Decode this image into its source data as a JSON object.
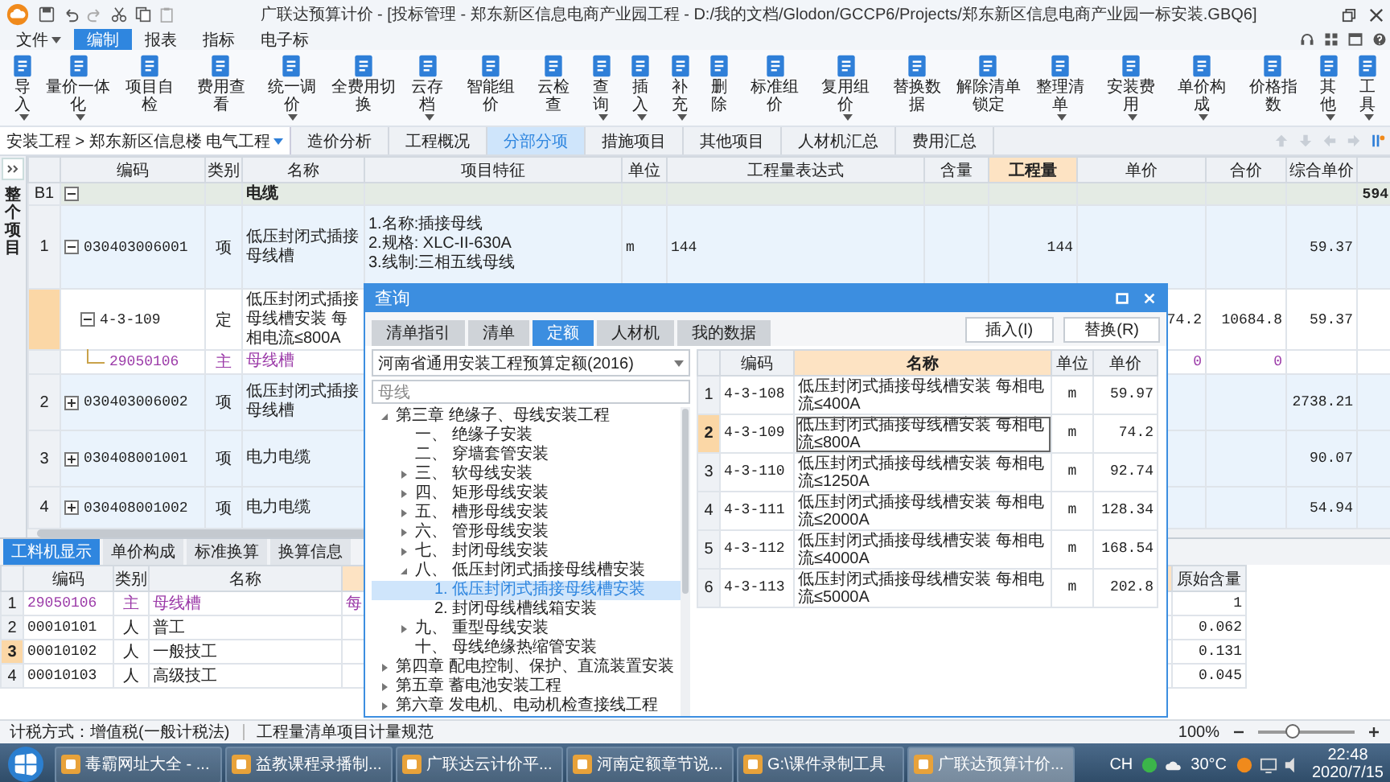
{
  "window": {
    "title": "广联达预算计价 - [投标管理 - 郑东新区信息电商产业园工程 - D:/我的文档/Glodon/GCCP6/Projects/郑东新区信息电商产业园一标安装.GBQ6]"
  },
  "menu": [
    {
      "label": "文件",
      "dropdown": true,
      "selected": false
    },
    {
      "label": "编制",
      "selected": true
    },
    {
      "label": "报表",
      "selected": false
    },
    {
      "label": "指标",
      "selected": false
    },
    {
      "label": "电子标",
      "selected": false
    }
  ],
  "ribbon": [
    {
      "label": "导入",
      "dropdown": true
    },
    {
      "label": "量价一体化",
      "dropdown": true
    },
    {
      "label": "项目自检"
    },
    {
      "label": "费用查看"
    },
    {
      "label": "统一调价",
      "dropdown": true
    },
    {
      "label": "全费用切换"
    },
    {
      "label": "云存档",
      "dropdown": true
    },
    {
      "label": "智能组价"
    },
    {
      "label": "云检查"
    },
    {
      "label": "查询",
      "dropdown": true
    },
    {
      "label": "插入",
      "dropdown": true
    },
    {
      "label": "补充",
      "dropdown": true
    },
    {
      "label": "删除"
    },
    {
      "label": "标准组价"
    },
    {
      "label": "复用组价",
      "dropdown": true
    },
    {
      "label": "替换数据"
    },
    {
      "label": "解除清单锁定"
    },
    {
      "label": "整理清单",
      "dropdown": true
    },
    {
      "label": "安装费用",
      "dropdown": true
    },
    {
      "label": "单价构成",
      "dropdown": true
    },
    {
      "label": "价格指数"
    },
    {
      "label": "其他",
      "dropdown": true
    },
    {
      "label": "工具",
      "dropdown": true
    }
  ],
  "nav": {
    "breadcrumb": "安装工程 > 郑东新区信息楼 电气工程",
    "tabs": [
      {
        "label": "造价分析",
        "selected": false
      },
      {
        "label": "工程概况",
        "selected": false
      },
      {
        "label": "分部分项",
        "selected": true
      },
      {
        "label": "措施项目",
        "selected": false
      },
      {
        "label": "其他项目",
        "selected": false
      },
      {
        "label": "人材机汇总",
        "selected": false
      },
      {
        "label": "费用汇总",
        "selected": false
      }
    ]
  },
  "main": {
    "side_label": "整个项目",
    "columns": [
      {
        "label": "编码",
        "highlighted": false
      },
      {
        "label": "类别",
        "highlighted": false
      },
      {
        "label": "名称",
        "highlighted": false
      },
      {
        "label": "项目特征",
        "highlighted": false
      },
      {
        "label": "单位",
        "highlighted": false
      },
      {
        "label": "工程量表达式",
        "highlighted": false
      },
      {
        "label": "含量",
        "highlighted": false
      },
      {
        "label": "工程量",
        "highlighted": true
      },
      {
        "label": "单价",
        "highlighted": false
      },
      {
        "label": "合价",
        "highlighted": false
      },
      {
        "label": "综合单价",
        "highlighted": false
      }
    ],
    "rows": [
      {
        "kind": "section",
        "num": "B1",
        "name": "电缆",
        "expanded": true,
        "column_13": "594",
        "selected": false
      },
      {
        "kind": "item",
        "num": "1",
        "code": "030403006001",
        "type": "项",
        "name": "低压封闭式插接母线槽",
        "features": [
          "1.名称:插接母线",
          "2.规格: XLC-II-630A",
          "3.线制:三相五线母线"
        ],
        "unit": "m",
        "expr": "144",
        "qty": "144",
        "unit_price": "59.37",
        "expanded": true,
        "selected": false
      },
      {
        "kind": "quota",
        "code": "4-3-109",
        "type": "定",
        "name": "低压封闭式插接母线槽安装 每相电流≤800A",
        "price": "74.2",
        "total": "10684.8",
        "unit_price": "59.37",
        "expanded": true,
        "selected": true
      },
      {
        "kind": "material",
        "code": "29050106",
        "type": "主",
        "name": "母线槽",
        "price": "0",
        "total": "0",
        "selected": false
      },
      {
        "kind": "item",
        "num": "2",
        "code": "030403006002",
        "type": "项",
        "name": "低压封闭式插接母线槽",
        "unit_price": "2738.21",
        "expanded": false,
        "selected": false
      },
      {
        "kind": "item",
        "num": "3",
        "code": "030408001001",
        "type": "项",
        "name": "电力电缆",
        "unit_price": "90.07",
        "expanded": false,
        "selected": false
      },
      {
        "kind": "item",
        "num": "4",
        "code": "030408001002",
        "type": "项",
        "name": "电力电缆",
        "unit_price": "54.94",
        "expanded": false,
        "selected": false
      }
    ]
  },
  "bottom": {
    "tabs": [
      {
        "label": "工料机显示",
        "selected": true
      },
      {
        "label": "单价构成",
        "selected": false
      },
      {
        "label": "标准换算",
        "selected": false
      },
      {
        "label": "换算信息",
        "selected": false
      }
    ],
    "columns": [
      "编码",
      "类别",
      "名称"
    ],
    "original_header": "原始含量",
    "rows": [
      {
        "kind": "material",
        "num": "1",
        "code": "29050106",
        "type": "主",
        "name": "母线槽",
        "column_5": "每",
        "original": "1",
        "selected": false
      },
      {
        "kind": "labor",
        "num": "2",
        "code": "00010101",
        "type": "人",
        "name": "普工",
        "original": "0.062",
        "selected": false
      },
      {
        "kind": "labor",
        "num": "3",
        "code": "00010102",
        "type": "人",
        "name": "一般技工",
        "original": "0.131",
        "selected": true
      },
      {
        "kind": "labor",
        "num": "4",
        "code": "00010103",
        "type": "人",
        "name": "高级技工",
        "original": "0.045",
        "selected": false
      }
    ]
  },
  "dialog": {
    "title": "查询",
    "tabs": [
      {
        "label": "清单指引",
        "selected": false
      },
      {
        "label": "清单",
        "selected": false
      },
      {
        "label": "定额",
        "selected": true
      },
      {
        "label": "人材机",
        "selected": false
      },
      {
        "label": "我的数据",
        "selected": false
      }
    ],
    "buttons": [
      "插入(I)",
      "替换(R)"
    ],
    "library": "河南省通用安装工程预算定额(2016)",
    "search": "母线",
    "tree": [
      {
        "label": "第三章 绝缘子、母线安装工程",
        "expanded": true,
        "selected": false,
        "children": [
          {
            "label": "一、 绝缘子安装",
            "selected": false
          },
          {
            "label": "二、 穿墙套管安装",
            "selected": false
          },
          {
            "label": "三、 软母线安装",
            "expanded": false,
            "selected": false
          },
          {
            "label": "四、 矩形母线安装",
            "expanded": false,
            "selected": false
          },
          {
            "label": "五、 槽形母线安装",
            "expanded": false,
            "selected": false
          },
          {
            "label": "六、 管形母线安装",
            "expanded": false,
            "selected": false
          },
          {
            "label": "七、 封闭母线安装",
            "expanded": false,
            "selected": false
          },
          {
            "label": "八、 低压封闭式插接母线槽安装",
            "expanded": true,
            "selected": false,
            "children": [
              {
                "label": "1. 低压封闭式插接母线槽安装",
                "selected": true
              },
              {
                "label": "2. 封闭母线槽线箱安装",
                "selected": false
              }
            ]
          },
          {
            "label": "九、 重型母线安装",
            "expanded": false,
            "selected": false
          },
          {
            "label": "十、 母线绝缘热缩管安装",
            "selected": false
          }
        ]
      },
      {
        "label": "第四章 配电控制、保护、直流装置安装",
        "expanded": false,
        "selected": false
      },
      {
        "label": "第五章 蓄电池安装工程",
        "expanded": false,
        "selected": false
      },
      {
        "label": "第六章 发电机、电动机检查接线工程",
        "expanded": false,
        "selected": false
      }
    ],
    "table": {
      "columns": [
        "编码",
        "名称",
        "单位",
        "单价"
      ],
      "rows": [
        {
          "num": "1",
          "code": "4-3-108",
          "name": "低压封闭式插接母线槽安装 每相电流≤400A",
          "unit": "m",
          "price": "59.97",
          "selected": false
        },
        {
          "num": "2",
          "code": "4-3-109",
          "name": "低压封闭式插接母线槽安装 每相电流≤800A",
          "unit": "m",
          "price": "74.2",
          "selected": true
        },
        {
          "num": "3",
          "code": "4-3-110",
          "name": "低压封闭式插接母线槽安装 每相电流≤1250A",
          "unit": "m",
          "price": "92.74",
          "selected": false
        },
        {
          "num": "4",
          "code": "4-3-111",
          "name": "低压封闭式插接母线槽安装 每相电流≤2000A",
          "unit": "m",
          "price": "128.34",
          "selected": false
        },
        {
          "num": "5",
          "code": "4-3-112",
          "name": "低压封闭式插接母线槽安装 每相电流≤4000A",
          "unit": "m",
          "price": "168.54",
          "selected": false
        },
        {
          "num": "6",
          "code": "4-3-113",
          "name": "低压封闭式插接母线槽安装 每相电流≤5000A",
          "unit": "m",
          "price": "202.8",
          "selected": false
        }
      ]
    }
  },
  "status": {
    "tax": "计税方式：增值税(一般计税法)",
    "spec": "工程量清单项目计量规范",
    "zoom": {
      "label": "100%",
      "level": 0.35
    }
  },
  "taskbar": {
    "items": [
      {
        "label": "毒霸网址大全 - ...",
        "selected": false
      },
      {
        "label": "益教课程录播制...",
        "selected": false
      },
      {
        "label": "广联达云计价平...",
        "selected": false
      },
      {
        "label": "河南定额章节说...",
        "selected": false
      },
      {
        "label": "G:\\课件录制工具",
        "selected": false
      },
      {
        "label": "广联达预算计价...",
        "selected": true
      }
    ],
    "language": "CH",
    "temperature": "30°C",
    "time": "22:48",
    "date": "2020/7/15"
  }
}
